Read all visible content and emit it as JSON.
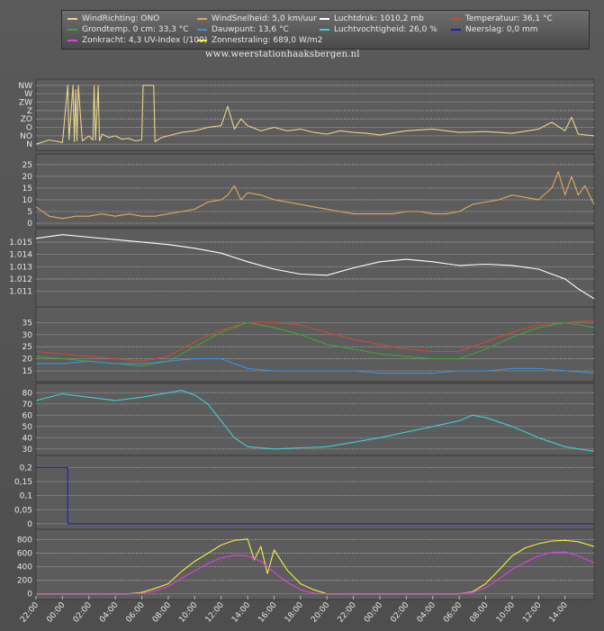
{
  "legend": {
    "wind_dir": "WindRichting: ONO",
    "wind_speed": "WindSnelheid: 5,0 km/uur",
    "pressure": "Luchtdruk: 1010,2 mb",
    "temperature": "Temperatuur: 36,1 °C",
    "ground_temp": "Grondtemp. 0 cm: 33,3 °C",
    "dew_point": "Dauwpunt: 13,6 °C",
    "humidity": "Luchtvochtigheid: 26,0 %",
    "rain": "Neerslag: 0,0 mm",
    "uv": "Zonkracht: 4,3 UV-Index (/100)",
    "solar": "Zonnestraling: 689,0 W/m2"
  },
  "watermark": "www.weerstationhaaksbergen.nl",
  "colors": {
    "wind_dir": "#e8d48a",
    "wind_speed": "#e0a860",
    "pressure": "#ffffff",
    "temperature": "#c84a3a",
    "ground_temp": "#3fa33a",
    "dew_point": "#3f8fe0",
    "humidity": "#40d0d0",
    "rain": "#1a1ad0",
    "uv": "#e040e0",
    "solar": "#f0f040"
  },
  "chart_data": {
    "type": "line",
    "x_tick_labels": [
      "22:00",
      "00:00",
      "02:00",
      "04:00",
      "06:00",
      "08:00",
      "10:00",
      "12:00",
      "14:00",
      "16:00",
      "18:00",
      "20:00",
      "22:00",
      "00:00",
      "02:00",
      "04:00",
      "06:00",
      "08:00",
      "10:00",
      "12:00",
      "14:00"
    ],
    "x_range_hours": [
      -2,
      40.2
    ],
    "panels": [
      {
        "id": "wind_dir",
        "ylabels": [
          "NW",
          "W",
          "ZW",
          "Z",
          "ZO",
          "O",
          "NO",
          "N"
        ],
        "yticks": [
          7,
          6,
          5,
          4,
          3,
          2,
          1,
          0
        ],
        "ylim": [
          -0.3,
          7.3
        ],
        "series": [
          {
            "name": "WindRichting",
            "key": "wind_dir",
            "x": [
              -2,
              -1,
              0,
              0.4,
              0.5,
              0.8,
              0.9,
              1,
              1.1,
              1.2,
              1.5,
              2,
              2.3,
              2.4,
              2.5,
              2.7,
              2.8,
              3,
              3.5,
              4,
              4.5,
              5,
              5.5,
              6,
              6.1,
              6.2,
              6.9,
              7,
              7.2,
              7.5,
              8,
              9,
              10,
              11,
              12,
              12.5,
              13,
              13.5,
              14,
              15,
              16,
              17,
              18,
              19,
              20,
              21,
              22,
              23,
              24,
              26,
              28,
              30,
              32,
              34,
              36,
              37,
              38,
              38.5,
              39,
              40.2
            ],
            "y": [
              0,
              0.5,
              0.2,
              7,
              0.5,
              7,
              0.3,
              6.5,
              0.4,
              7,
              0.4,
              1,
              0.5,
              7,
              0.5,
              7,
              0.4,
              1.2,
              0.8,
              1,
              0.6,
              0.7,
              0.4,
              0.5,
              7,
              7,
              7,
              0.3,
              0.5,
              0.8,
              1,
              1.4,
              1.6,
              2,
              2.2,
              4.5,
              1.8,
              3,
              2.2,
              1.6,
              2,
              1.6,
              1.8,
              1.4,
              1.2,
              1.6,
              1.4,
              1.3,
              1.1,
              1.6,
              1.8,
              1.4,
              1.5,
              1.3,
              1.8,
              2.6,
              1.6,
              3.2,
              1.2,
              1
            ]
          }
        ]
      },
      {
        "id": "wind_speed",
        "yticks": [
          0,
          5,
          10,
          15,
          20,
          25
        ],
        "ylim": [
          0,
          28
        ],
        "series": [
          {
            "name": "WindSnelheid",
            "key": "wind_speed",
            "x": [
              -2,
              -1,
              0,
              1,
              2,
              3,
              4,
              5,
              6,
              7,
              8,
              9,
              10,
              11,
              12,
              12.5,
              13,
              13.5,
              14,
              15,
              16,
              17,
              18,
              19,
              20,
              21,
              22,
              23,
              24,
              25,
              26,
              27,
              28,
              29,
              30,
              31,
              32,
              33,
              34,
              35,
              36,
              37,
              37.5,
              38,
              38.5,
              39,
              39.5,
              40.2
            ],
            "y": [
              7,
              3,
              2,
              3,
              3,
              4,
              3,
              4,
              3,
              3,
              4,
              5,
              6,
              9,
              10,
              12,
              16,
              10,
              13,
              12,
              10,
              9,
              8,
              7,
              6,
              5,
              4,
              4,
              4,
              4,
              5,
              5,
              4,
              4,
              5,
              8,
              9,
              10,
              12,
              11,
              10,
              15,
              22,
              12,
              20,
              12,
              16,
              8
            ]
          }
        ]
      },
      {
        "id": "pressure",
        "yticks": [
          1.011,
          1.012,
          1.013,
          1.014,
          1.015
        ],
        "ylabels": [
          "1.011",
          "1.012",
          "1.013",
          "1.014",
          "1.015"
        ],
        "ylim": [
          1.0098,
          1.0158
        ],
        "series": [
          {
            "name": "Luchtdruk",
            "key": "pressure",
            "x": [
              -2,
              0,
              2,
              4,
              6,
              8,
              10,
              12,
              14,
              16,
              18,
              20,
              22,
              24,
              26,
              28,
              30,
              32,
              34,
              36,
              37,
              38,
              39,
              40.2
            ],
            "y": [
              1.0153,
              1.0156,
              1.0154,
              1.0152,
              1.015,
              1.0148,
              1.0145,
              1.0141,
              1.0134,
              1.0128,
              1.0124,
              1.0123,
              1.0129,
              1.0134,
              1.0136,
              1.0134,
              1.0131,
              1.0132,
              1.0131,
              1.0128,
              1.0124,
              1.012,
              1.0112,
              1.0104
            ]
          }
        ]
      },
      {
        "id": "temperature",
        "yticks": [
          15,
          20,
          25,
          30,
          35
        ],
        "ylim": [
          12,
          40
        ],
        "series": [
          {
            "name": "Temperatuur",
            "key": "temperature",
            "x": [
              -2,
              0,
              2,
              4,
              6,
              8,
              10,
              12,
              14,
              16,
              18,
              20,
              22,
              24,
              26,
              28,
              30,
              32,
              34,
              36,
              38,
              40.2
            ],
            "y": [
              23,
              22,
              21,
              20,
              19,
              21,
              27,
              32,
              35,
              35,
              34,
              31,
              28,
              26,
              24,
              23,
              23,
              27,
              31,
              34,
              35,
              36
            ]
          },
          {
            "name": "Grondtemp.",
            "key": "ground_temp",
            "x": [
              -2,
              0,
              2,
              4,
              6,
              8,
              10,
              12,
              14,
              16,
              18,
              20,
              22,
              24,
              26,
              28,
              30,
              32,
              34,
              36,
              38,
              40.2
            ],
            "y": [
              21,
              20,
              19,
              18,
              17,
              19,
              25,
              31,
              35,
              33,
              30,
              26,
              24,
              22,
              21,
              20,
              20,
              24,
              29,
              33,
              35,
              33
            ]
          },
          {
            "name": "Dauwpunt",
            "key": "dew_point",
            "x": [
              -2,
              0,
              2,
              4,
              6,
              8,
              10,
              12,
              14,
              16,
              18,
              20,
              22,
              24,
              26,
              28,
              30,
              32,
              34,
              36,
              38,
              40.2
            ],
            "y": [
              18,
              18,
              19,
              18,
              18,
              19,
              20,
              20,
              16,
              15,
              15,
              15,
              15,
              14,
              14,
              14,
              15,
              15,
              16,
              16,
              15,
              14
            ]
          }
        ]
      },
      {
        "id": "humidity",
        "yticks": [
          30,
          40,
          50,
          60,
          70,
          80
        ],
        "ylim": [
          25,
          85
        ],
        "series": [
          {
            "name": "Luchtvochtigheid",
            "key": "humidity",
            "x": [
              -2,
              0,
              2,
              4,
              6,
              8,
              9,
              10,
              11,
              12,
              13,
              14,
              16,
              18,
              20,
              22,
              24,
              26,
              28,
              30,
              31,
              32,
              34,
              36,
              38,
              40.2
            ],
            "y": [
              73,
              79,
              76,
              73,
              76,
              80,
              82,
              78,
              70,
              55,
              40,
              32,
              30,
              31,
              32,
              36,
              40,
              45,
              50,
              55,
              60,
              58,
              50,
              40,
              32,
              28
            ]
          }
        ]
      },
      {
        "id": "rain",
        "yticks": [
          0,
          0.05,
          0.1,
          0.15,
          0.2
        ],
        "ylabels": [
          "0",
          "0,05",
          "0,1",
          "0,15",
          "0,2"
        ],
        "ylim": [
          -0.01,
          0.23
        ],
        "series": [
          {
            "name": "Neerslag",
            "key": "rain",
            "x": [
              -2,
              0,
              0.4,
              40.2
            ],
            "y": [
              0.2,
              0.2,
              0,
              0
            ]
          }
        ]
      },
      {
        "id": "solar",
        "yticks": [
          0,
          200,
          400,
          600,
          800
        ],
        "ylim": [
          -30,
          900
        ],
        "series": [
          {
            "name": "Zonnestraling",
            "key": "solar",
            "x": [
              -2,
              5,
              6,
              7,
              8,
              9,
              10,
              11,
              12,
              13,
              14,
              14.5,
              15,
              15.5,
              16,
              17,
              18,
              19,
              20,
              30,
              31,
              32,
              33,
              34,
              35,
              36,
              37,
              38,
              39,
              40.2
            ],
            "y": [
              0,
              0,
              20,
              80,
              150,
              330,
              480,
              600,
              720,
              790,
              810,
              500,
              700,
              300,
              650,
              350,
              150,
              60,
              0,
              0,
              30,
              150,
              350,
              560,
              680,
              740,
              780,
              790,
              770,
              700
            ]
          },
          {
            "name": "Zonkracht",
            "key": "uv",
            "x": [
              -2,
              5,
              6,
              7,
              8,
              9,
              10,
              11,
              12,
              13,
              14,
              15,
              16,
              17,
              18,
              19,
              20,
              30,
              31,
              32,
              33,
              34,
              35,
              36,
              37,
              38,
              39,
              40.2
            ],
            "y": [
              0,
              0,
              10,
              40,
              110,
              230,
              340,
              450,
              530,
              570,
              560,
              480,
              320,
              170,
              60,
              10,
              0,
              0,
              20,
              90,
              220,
              360,
              470,
              560,
              610,
              620,
              560,
              460
            ]
          }
        ]
      }
    ]
  }
}
